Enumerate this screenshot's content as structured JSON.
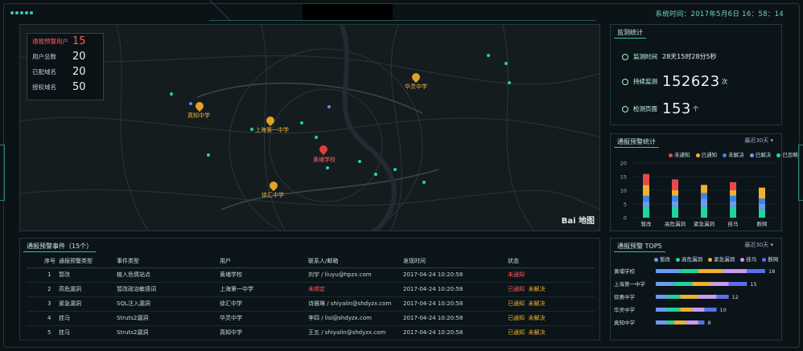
{
  "header": {
    "clock": "系统时间：2017年5月6日 16：58：14"
  },
  "stats": [
    {
      "label": "通报预警用户",
      "value": "15",
      "alert": true
    },
    {
      "label": "用户总数",
      "value": "20"
    },
    {
      "label": "已配域名",
      "value": "20"
    },
    {
      "label": "授权域名",
      "value": "50"
    }
  ],
  "map": {
    "pins": [
      {
        "name": "真知中学",
        "color": "orange"
      },
      {
        "name": "上海第一中学",
        "color": "orange"
      },
      {
        "name": "华灵中学",
        "color": "orange"
      },
      {
        "name": "黄埔学校",
        "color": "red"
      },
      {
        "name": "徐汇中学",
        "color": "orange"
      }
    ],
    "logo": "Bai 地图"
  },
  "events": {
    "title": "通报预警事件（15个）",
    "columns": [
      "序号",
      "通报预警类型",
      "事件类型",
      "用户",
      "联系人/邮箱",
      "发现时间",
      "状态"
    ],
    "rows": [
      {
        "no": "1",
        "type": "暂改",
        "event": "植入色情站点",
        "user": "黄埔学校",
        "contact": "刘宇 / liuyu@hpzx.com",
        "time": "2017-04-24  10:20:58",
        "status": "未通知",
        "status2": ""
      },
      {
        "no": "2",
        "type": "高危漏洞",
        "event": "暂改政治敏感词",
        "user": "上海第一中学",
        "contact": "未绑定",
        "time": "2017-04-24  10:20:58",
        "status": "已通知",
        "status2": "未解决"
      },
      {
        "no": "3",
        "type": "紧急漏洞",
        "event": "SQL注入漏洞",
        "user": "徐汇中学",
        "contact": "诗雅琳 / shiyalin@shdyzx.com",
        "time": "2017-04-24  10:20:58",
        "status": "已通知",
        "status2": "未解决"
      },
      {
        "no": "4",
        "type": "挂马",
        "event": "Struts2漏洞",
        "user": "华灵中学",
        "contact": "李四 / lisi@shdyzx.com",
        "time": "2017-04-24  10:20:58",
        "status": "已通知",
        "status2": "未解决"
      },
      {
        "no": "5",
        "type": "挂马",
        "event": "Struts2漏洞",
        "user": "真知中学",
        "contact": "王五 / shiyalin@shdyzx.com",
        "time": "2017-04-24  10:20:58",
        "status": "已通知",
        "status2": "未解决"
      }
    ]
  },
  "monitor": {
    "title": "监测统计",
    "duration_label": "监测时间",
    "duration_value": "28天15时28分5秒",
    "continuous_label": "持续监测",
    "continuous_value": "152623",
    "continuous_unit": "次",
    "pages_label": "检测页面",
    "pages_value": "153",
    "pages_unit": "个"
  },
  "alert_chart": {
    "title": "通报预警统计",
    "range": "最近30天 ▾",
    "legend": [
      {
        "name": "未通知",
        "color": "#e84a4a"
      },
      {
        "name": "已通知",
        "color": "#f0b030"
      },
      {
        "name": "未解决",
        "color": "#3a86e8"
      },
      {
        "name": "已解决",
        "color": "#6a9cf0"
      },
      {
        "name": "已忽略",
        "color": "#20d49a"
      }
    ]
  },
  "top5": {
    "title": "通报预警 TOP5",
    "range": "最近30天 ▾",
    "legend": [
      {
        "name": "暂改",
        "color": "#6a9cf0"
      },
      {
        "name": "高危漏洞",
        "color": "#20d49a"
      },
      {
        "name": "紧急漏洞",
        "color": "#f0b030"
      },
      {
        "name": "挂马",
        "color": "#c89cf0"
      },
      {
        "name": "断网",
        "color": "#5a6ef0"
      }
    ]
  },
  "chart_data": [
    {
      "type": "bar",
      "stacked": true,
      "categories": [
        "暂改",
        "高危漏洞",
        "紧急漏洞",
        "挂马",
        "断网"
      ],
      "ylim": [
        0,
        20
      ],
      "yticks": [
        0,
        5,
        10,
        15,
        20
      ],
      "series": [
        {
          "name": "未通知",
          "values": [
            4,
            4,
            0,
            3,
            0
          ]
        },
        {
          "name": "已通知",
          "values": [
            4,
            2,
            3,
            2,
            4
          ]
        },
        {
          "name": "未解决",
          "values": [
            2,
            2,
            2,
            2,
            2
          ]
        },
        {
          "name": "已解决",
          "values": [
            2,
            2,
            3,
            2,
            2
          ]
        },
        {
          "name": "已忽略",
          "values": [
            4,
            4,
            4,
            4,
            3
          ]
        }
      ]
    },
    {
      "type": "bar",
      "orientation": "horizontal",
      "stacked": true,
      "categories": [
        "黄埔学校",
        "上海第一中学",
        "徐惠中学",
        "华灵中学",
        "真知中学"
      ],
      "totals": [
        18,
        15,
        12,
        10,
        8
      ],
      "series": [
        {
          "name": "暂改",
          "values": [
            4,
            3,
            2,
            2,
            2
          ]
        },
        {
          "name": "高危漏洞",
          "values": [
            3,
            3,
            2,
            2,
            1
          ]
        },
        {
          "name": "紧急漏洞",
          "values": [
            4,
            3,
            3,
            2,
            2
          ]
        },
        {
          "name": "挂马",
          "values": [
            4,
            3,
            3,
            2,
            2
          ]
        },
        {
          "name": "断网",
          "values": [
            3,
            3,
            2,
            2,
            1
          ]
        }
      ]
    }
  ]
}
